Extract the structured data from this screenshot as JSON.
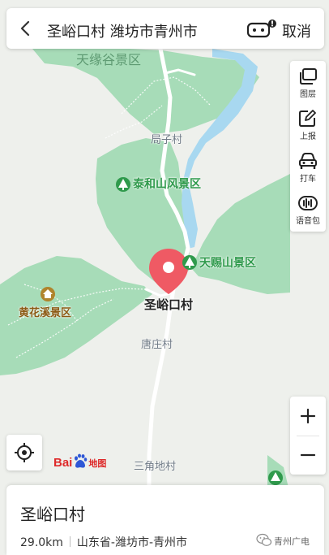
{
  "search_bar": {
    "query": "圣峪口村 潍坊市青州市",
    "cancel_label": "取消",
    "back_icon": "chevron-left-icon",
    "assistant_icon": "robot-assistant-icon"
  },
  "tools": [
    {
      "label": "图层",
      "icon": "layers-icon"
    },
    {
      "label": "上报",
      "icon": "report-edit-icon"
    },
    {
      "label": "打车",
      "icon": "taxi-icon"
    },
    {
      "label": "语音包",
      "icon": "voice-pack-icon"
    }
  ],
  "map": {
    "region_label": "天缘谷景区",
    "selected_place": "圣峪口村",
    "pois": [
      {
        "name": "泰和山风景区",
        "type": "scenic"
      },
      {
        "name": "天赐山景区",
        "type": "scenic"
      },
      {
        "name": "黄花溪景区",
        "type": "scenic-feature"
      }
    ],
    "villages": [
      "局子村",
      "唐庄村",
      "三角地村"
    ],
    "colors": {
      "land": "#eef0ec",
      "park": "#a7dcb8",
      "water": "#a8d8f0",
      "road": "#ffffff",
      "marker": "#ef5a64",
      "poi_green": "#2f9a4c",
      "poi_brown": "#8b5a14"
    }
  },
  "controls": {
    "zoom_in": "+",
    "zoom_out": "−",
    "locate_icon": "locate-crosshair-icon"
  },
  "logo": {
    "bai": "Bai",
    "du_icon": "baidu-paw-icon",
    "map": "地图"
  },
  "place_card": {
    "title": "圣峪口村",
    "distance": "29.0km",
    "address": "山东省-潍坊市-青州市"
  },
  "watermark": {
    "text": "青州广电",
    "icon": "wechat-icon"
  }
}
